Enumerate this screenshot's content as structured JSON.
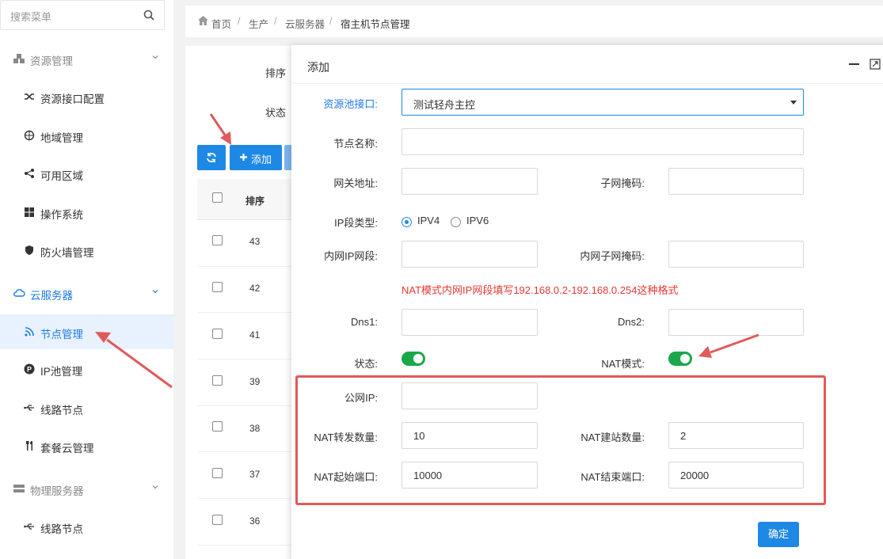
{
  "sidebar": {
    "search_placeholder": "搜索菜单",
    "groups": [
      {
        "label": "资源管理",
        "icon": "cubes-icon"
      },
      {
        "label": "云服务器",
        "icon": "cloud-icon"
      },
      {
        "label": "物理服务器",
        "icon": "server-icon"
      }
    ],
    "items": [
      {
        "label": "资源接口配置",
        "icon": "shuffle-icon"
      },
      {
        "label": "地域管理",
        "icon": "globe-icon"
      },
      {
        "label": "可用区域",
        "icon": "share-icon"
      },
      {
        "label": "操作系统",
        "icon": "windows-icon"
      },
      {
        "label": "防火墙管理",
        "icon": "shield-icon"
      },
      {
        "label": "节点管理",
        "icon": "rss-icon",
        "active": true
      },
      {
        "label": "IP池管理",
        "icon": "parking-icon"
      },
      {
        "label": "线路节点",
        "icon": "usb-icon"
      },
      {
        "label": "套餐云管理",
        "icon": "cutlery-icon"
      },
      {
        "label": "线路节点",
        "icon": "usb-icon"
      }
    ]
  },
  "breadcrumb": [
    "首页",
    "生产",
    "云服务器",
    "宿主机节点管理"
  ],
  "filters": {
    "sort_label": "排序",
    "status_label": "状态"
  },
  "toolbar": {
    "add_label": "添加"
  },
  "table": {
    "header_sort": "排序",
    "rows": [
      "43",
      "42",
      "41",
      "39",
      "38",
      "37",
      "36"
    ]
  },
  "modal": {
    "title": "添加",
    "pool_label": "资源池接口:",
    "pool_value": "测试轻舟主控",
    "node_name_label": "节点名称:",
    "gateway_label": "网关地址:",
    "subnet_label": "子网掩码:",
    "ip_type_label": "IP段类型:",
    "ipv4": "IPV4",
    "ipv6": "IPV6",
    "lan_ip_label": "内网IP网段:",
    "lan_mask_label": "内网子网掩码:",
    "hint": "NAT模式内网IP网段填写192.168.0.2-192.168.0.254这种格式",
    "dns1_label": "Dns1:",
    "dns2_label": "Dns2:",
    "status_label": "状态:",
    "nat_mode_label": "NAT模式:",
    "public_ip_label": "公网IP:",
    "nat_forward_label": "NAT转发数量:",
    "nat_forward_value": "10",
    "nat_site_label": "NAT建站数量:",
    "nat_site_value": "2",
    "nat_start_label": "NAT起始端口:",
    "nat_start_value": "10000",
    "nat_end_label": "NAT结束端口:",
    "nat_end_value": "20000",
    "confirm_label": "确定"
  },
  "colors": {
    "accent": "#1e88e5",
    "toggle_on": "#1aa84a",
    "annotation": "#e05a5a"
  }
}
